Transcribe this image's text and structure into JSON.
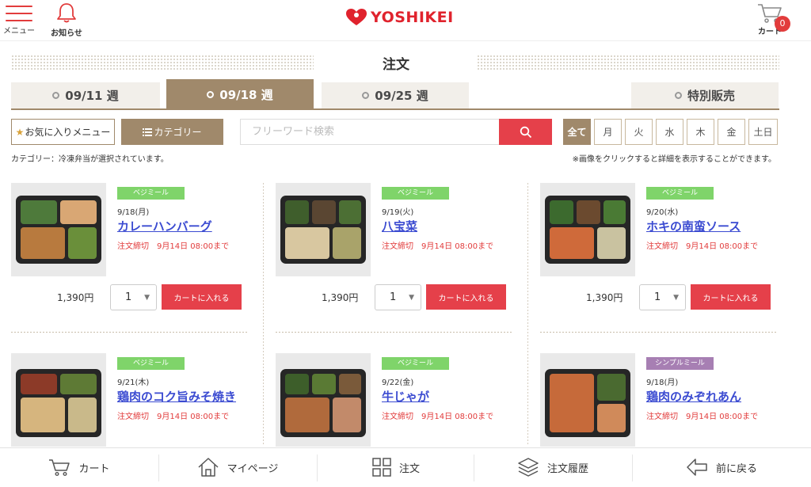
{
  "header": {
    "menu_label": "メニュー",
    "notice_label": "お知らせ",
    "logo_text": "YOSHIKEI",
    "cart_label": "カート",
    "cart_count": "0",
    "accent_color": "#e23c3c"
  },
  "page_title": "注文",
  "week_tabs": [
    {
      "label": "09/11 週",
      "active": false
    },
    {
      "label": "09/18 週",
      "active": true
    },
    {
      "label": "09/25 週",
      "active": false
    },
    {
      "label": "特別販売",
      "active": false
    }
  ],
  "filters": {
    "favorites_label": "お気に入りメニュー",
    "category_label": "カテゴリー",
    "search_placeholder": "フリーワード検索",
    "days": [
      "全て",
      "月",
      "火",
      "水",
      "木",
      "金",
      "土日"
    ]
  },
  "info": {
    "category_status": "カテゴリー：冷凍弁当が選択されています。",
    "click_hint": "※画像をクリックすると詳細を表示することができます。"
  },
  "products": [
    {
      "tag": "ベジミール",
      "date": "9/18(月)",
      "name": "カレーハンバーグ",
      "deadline": "注文締切　9月14日 08:00まで",
      "price": "1,390円",
      "qty": "1",
      "add_label": "カートに入れる"
    },
    {
      "tag": "ベジミール",
      "date": "9/19(火)",
      "name": "八宝菜",
      "deadline": "注文締切　9月14日 08:00まで",
      "price": "1,390円",
      "qty": "1",
      "add_label": "カートに入れる"
    },
    {
      "tag": "ベジミール",
      "date": "9/20(水)",
      "name": "ホキの南蛮ソース",
      "deadline": "注文締切　9月14日 08:00まで",
      "price": "1,390円",
      "qty": "1",
      "add_label": "カートに入れる"
    },
    {
      "tag": "ベジミール",
      "date": "9/21(木)",
      "name": "鶏肉のコク旨みそ焼き",
      "deadline": "注文締切　9月14日 08:00まで"
    },
    {
      "tag": "ベジミール",
      "date": "9/22(金)",
      "name": "牛じゃが",
      "deadline": "注文締切　9月14日 08:00まで"
    },
    {
      "tag": "シンプルミール",
      "date": "9/18(月)",
      "name": "鶏肉のみぞれあん",
      "deadline": "注文締切　9月14日 08:00まで"
    }
  ],
  "bottom_nav": [
    "カート",
    "マイページ",
    "注文",
    "注文履歴",
    "前に戻る"
  ]
}
